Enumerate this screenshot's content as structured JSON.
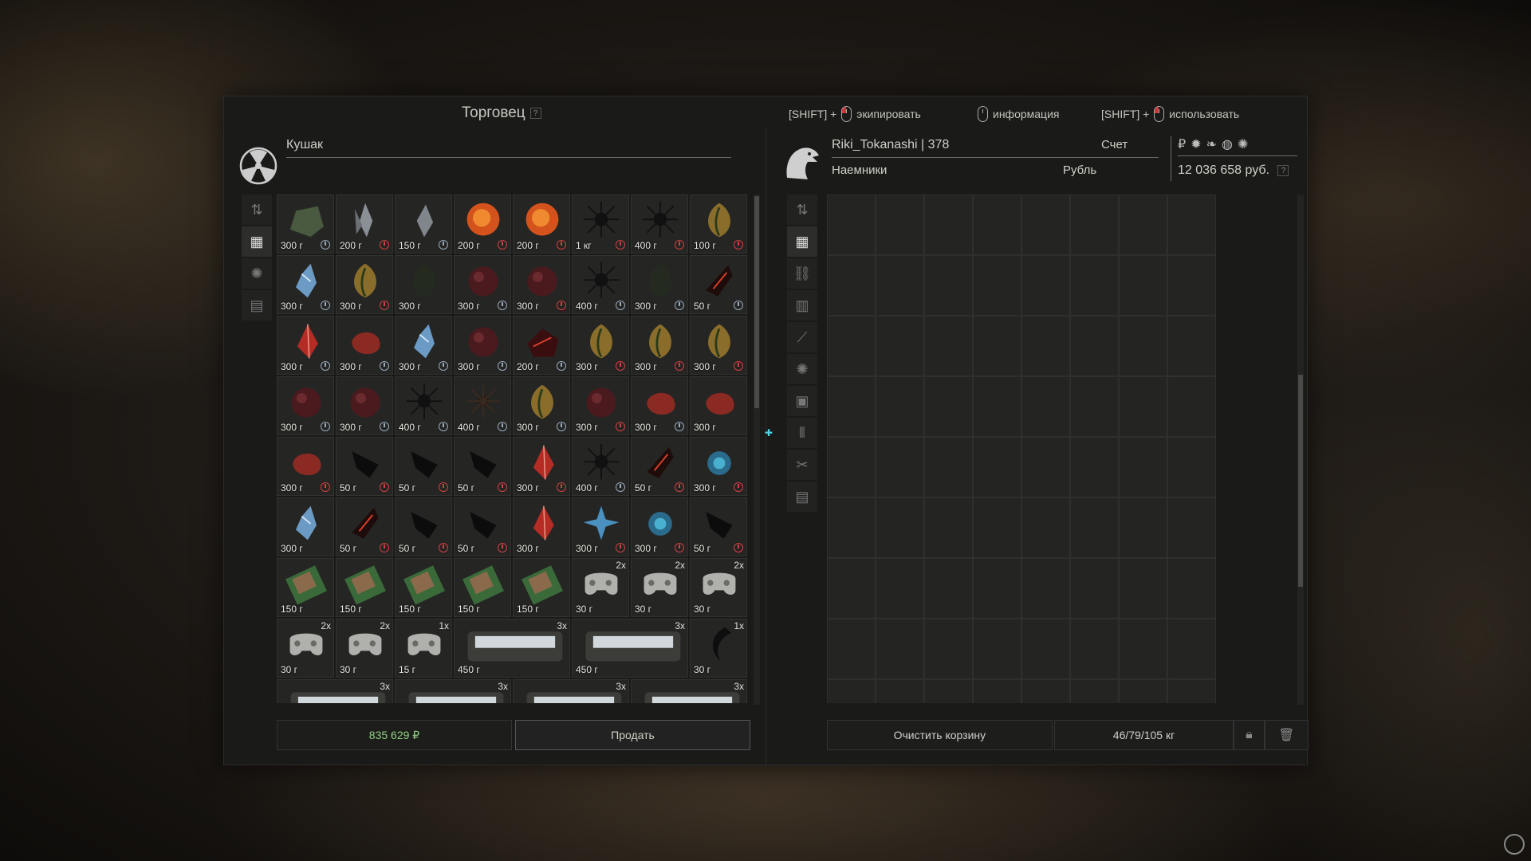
{
  "header": {
    "trader_title": "Торговец",
    "help": "?",
    "hints": [
      {
        "prefix": "[SHIFT] +",
        "label": "экипировать"
      },
      {
        "prefix": "",
        "label": "информация"
      },
      {
        "prefix": "[SHIFT] +",
        "label": "использовать"
      }
    ]
  },
  "trader": {
    "name": "Кушак"
  },
  "player": {
    "name": "Riki_Tokanashi | 378",
    "faction": "Наемники",
    "account_label": "Счет",
    "currency_label": "Рубль",
    "balance": "12 036 658 руб."
  },
  "left_sidebar": [
    {
      "icon": "sort-icon"
    },
    {
      "icon": "grid-icon"
    },
    {
      "icon": "artifact-icon"
    },
    {
      "icon": "box-icon"
    }
  ],
  "right_sidebar": [
    {
      "icon": "sort-icon"
    },
    {
      "icon": "grid-icon"
    },
    {
      "icon": "link-icon"
    },
    {
      "icon": "armor-icon"
    },
    {
      "icon": "rifle-icon"
    },
    {
      "icon": "artifact-icon"
    },
    {
      "icon": "camera-icon"
    },
    {
      "icon": "ammo-icon"
    },
    {
      "icon": "tools-icon"
    },
    {
      "icon": "box-icon"
    }
  ],
  "items": [
    {
      "price": "300 г",
      "clock": "blue",
      "kind": "rock"
    },
    {
      "price": "200 г",
      "clock": "red",
      "kind": "crystal"
    },
    {
      "price": "150 г",
      "clock": "blue",
      "kind": "crystal-grey"
    },
    {
      "price": "200 г",
      "clock": "red",
      "kind": "fire"
    },
    {
      "price": "200 г",
      "clock": "red",
      "kind": "fire"
    },
    {
      "price": "1 кг",
      "clock": "red",
      "kind": "urchin"
    },
    {
      "price": "400 г",
      "clock": "red",
      "kind": "urchin"
    },
    {
      "price": "100 г",
      "clock": "red",
      "kind": "pod"
    },
    {
      "price": "300 г",
      "clock": "blue",
      "kind": "ice"
    },
    {
      "price": "300 г",
      "clock": "red",
      "kind": "pod"
    },
    {
      "price": "300 г",
      "clock": "",
      "kind": "pod-dark"
    },
    {
      "price": "300 г",
      "clock": "blue",
      "kind": "meat"
    },
    {
      "price": "300 г",
      "clock": "red",
      "kind": "meat"
    },
    {
      "price": "400 г",
      "clock": "blue",
      "kind": "urchin"
    },
    {
      "price": "300 г",
      "clock": "blue",
      "kind": "pod-dark"
    },
    {
      "price": "50 г",
      "clock": "blue",
      "kind": "lava"
    },
    {
      "price": "300 г",
      "clock": "blue",
      "kind": "red-crystal"
    },
    {
      "price": "300 г",
      "clock": "blue",
      "kind": "red-blob"
    },
    {
      "price": "300 г",
      "clock": "blue",
      "kind": "ice"
    },
    {
      "price": "300 г",
      "clock": "blue",
      "kind": "meat"
    },
    {
      "price": "200 г",
      "clock": "blue",
      "kind": "lava-big"
    },
    {
      "price": "300 г",
      "clock": "red",
      "kind": "pod"
    },
    {
      "price": "300 г",
      "clock": "red",
      "kind": "pod"
    },
    {
      "price": "300 г",
      "clock": "red",
      "kind": "pod"
    },
    {
      "price": "300 г",
      "clock": "blue",
      "kind": "meat"
    },
    {
      "price": "300 г",
      "clock": "blue",
      "kind": "meat"
    },
    {
      "price": "400 г",
      "clock": "blue",
      "kind": "urchin"
    },
    {
      "price": "400 г",
      "clock": "blue",
      "kind": "urchin-brown"
    },
    {
      "price": "300 г",
      "clock": "blue",
      "kind": "pod"
    },
    {
      "price": "300 г",
      "clock": "red",
      "kind": "meat"
    },
    {
      "price": "300 г",
      "clock": "blue",
      "kind": "red-blob"
    },
    {
      "price": "300 г",
      "clock": "",
      "kind": "red-blob"
    },
    {
      "price": "300 г",
      "clock": "red",
      "kind": "red-blob"
    },
    {
      "price": "50 г",
      "clock": "red",
      "kind": "black-shard"
    },
    {
      "price": "50 г",
      "clock": "red",
      "kind": "black-shard"
    },
    {
      "price": "50 г",
      "clock": "red",
      "kind": "black-shard"
    },
    {
      "price": "300 г",
      "clock": "red",
      "kind": "red-crystal"
    },
    {
      "price": "400 г",
      "clock": "blue",
      "kind": "urchin"
    },
    {
      "price": "50 г",
      "clock": "red",
      "kind": "lava"
    },
    {
      "price": "300 г",
      "clock": "red",
      "kind": "blue-glow"
    },
    {
      "price": "300 г",
      "clock": "",
      "kind": "ice"
    },
    {
      "price": "50 г",
      "clock": "red",
      "kind": "lava"
    },
    {
      "price": "50 г",
      "clock": "red",
      "kind": "black-shard"
    },
    {
      "price": "50 г",
      "clock": "red",
      "kind": "black-shard"
    },
    {
      "price": "300 г",
      "clock": "",
      "kind": "red-crystal"
    },
    {
      "price": "300 г",
      "clock": "red",
      "kind": "blue-star"
    },
    {
      "price": "300 г",
      "clock": "red",
      "kind": "blue-glow"
    },
    {
      "price": "50 г",
      "clock": "red",
      "kind": "black-shard"
    },
    {
      "price": "150 г",
      "clock": "",
      "kind": "board"
    },
    {
      "price": "150 г",
      "clock": "",
      "kind": "board"
    },
    {
      "price": "150 г",
      "clock": "",
      "kind": "board"
    },
    {
      "price": "150 г",
      "clock": "",
      "kind": "board"
    },
    {
      "price": "150 г",
      "clock": "",
      "kind": "board"
    },
    {
      "price": "30 г",
      "clock": "",
      "kind": "gamepad",
      "count": "2x"
    },
    {
      "price": "30 г",
      "clock": "",
      "kind": "gamepad",
      "count": "2x"
    },
    {
      "price": "30 г",
      "clock": "",
      "kind": "gamepad",
      "count": "2x"
    },
    {
      "price": "30 г",
      "clock": "",
      "kind": "gamepad",
      "count": "2x"
    },
    {
      "price": "30 г",
      "clock": "",
      "kind": "gamepad",
      "count": "2x"
    },
    {
      "price": "15 г",
      "clock": "",
      "kind": "gamepad",
      "count": "1x"
    },
    {
      "price": "450 г",
      "clock": "",
      "kind": "container",
      "count": "3x",
      "wide": true
    },
    {
      "price": "450 г",
      "clock": "",
      "kind": "container",
      "count": "3x",
      "wide": true
    },
    {
      "price": "30 г",
      "clock": "",
      "kind": "claw",
      "count": "1x"
    },
    {
      "price": "",
      "clock": "",
      "kind": "container",
      "count": "3x",
      "wide": true
    },
    {
      "price": "",
      "clock": "",
      "kind": "container",
      "count": "3x",
      "wide": true
    },
    {
      "price": "",
      "clock": "",
      "kind": "container",
      "count": "3x",
      "wide": true
    },
    {
      "price": "",
      "clock": "",
      "kind": "container",
      "count": "3x",
      "wide": true
    }
  ],
  "footer": {
    "total": "835 629 ₽",
    "sell": "Продать",
    "clear_cart": "Очистить корзину",
    "weight": "46/79/105 кг"
  },
  "colors": {
    "total_green": "#8fd080",
    "clock_blue": "#99aabb",
    "clock_red": "#d04040"
  }
}
